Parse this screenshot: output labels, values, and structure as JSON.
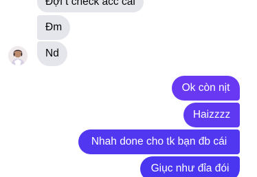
{
  "conversation": {
    "incoming": [
      {
        "text": "Đợi t check acc cái"
      },
      {
        "text": "Đm"
      },
      {
        "text": "Nd"
      }
    ],
    "outgoing": [
      {
        "text": "Ok còn nịt"
      },
      {
        "text": "Haizzzz"
      },
      {
        "text": "Nhah done cho tk bạn đb cái"
      },
      {
        "text": "Giục như đỉa đói"
      }
    ]
  },
  "colors": {
    "incoming_bubble": "#e4e6eb",
    "outgoing_top": "#6a39f2",
    "outgoing_bottom": "#4a36f1"
  }
}
